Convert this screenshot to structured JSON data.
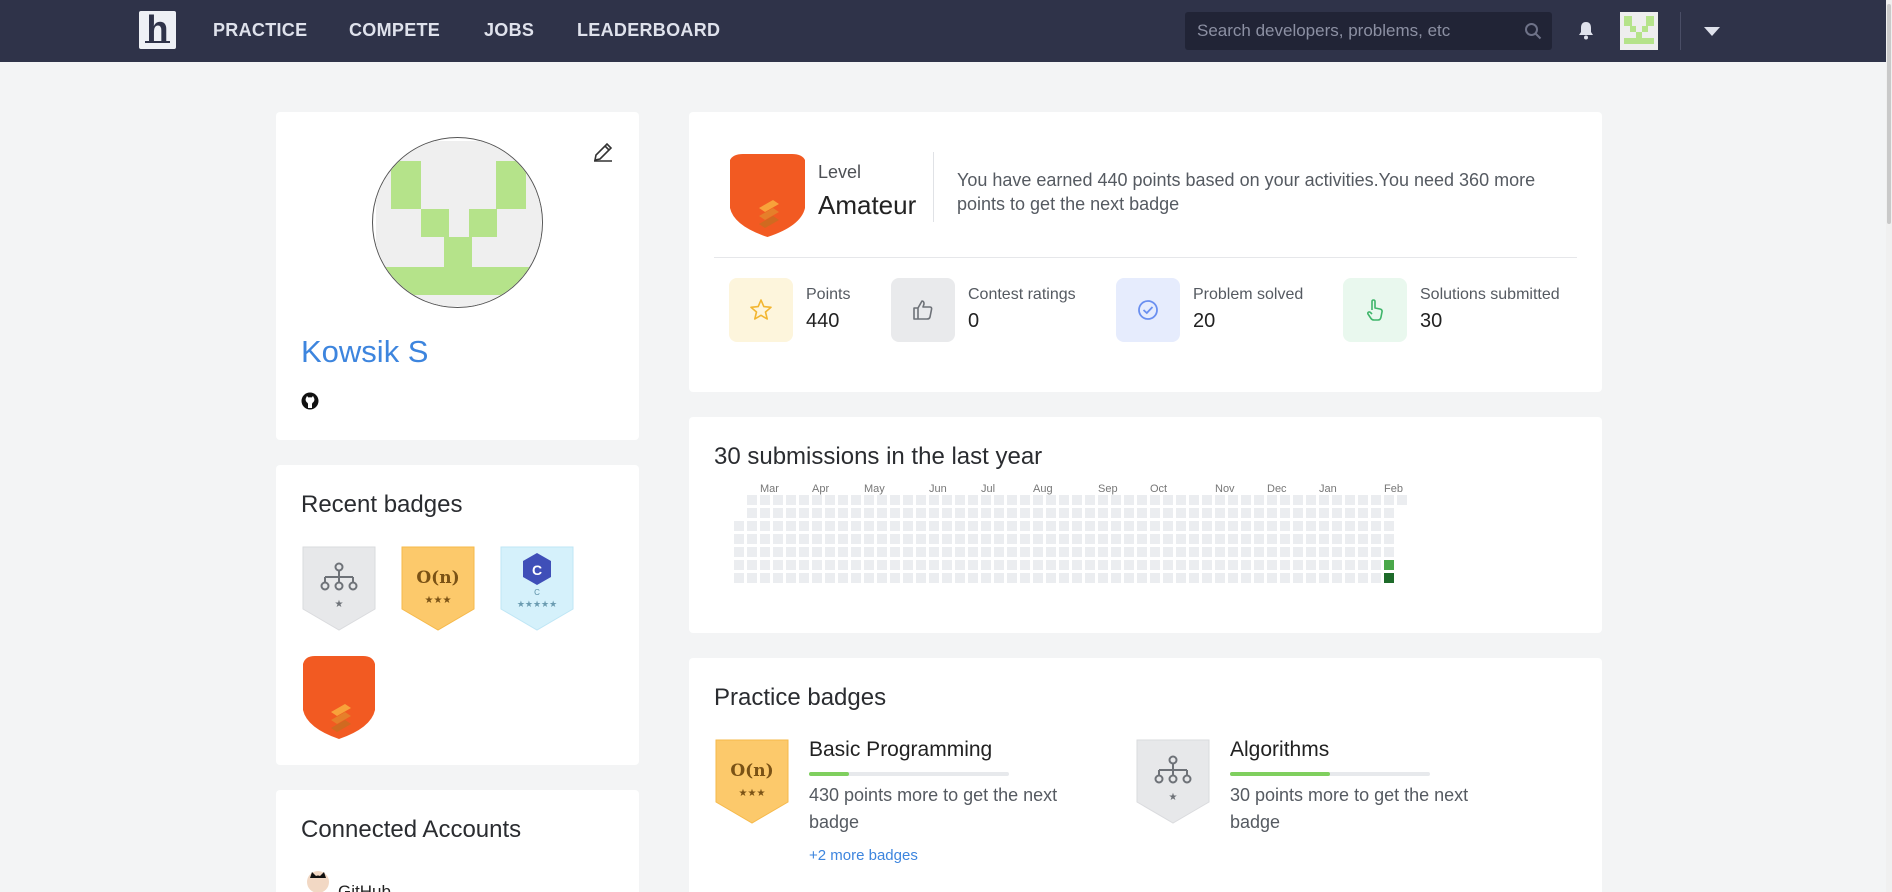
{
  "nav": {
    "logo_letter": "h",
    "links": [
      "PRACTICE",
      "COMPETE",
      "JOBS",
      "LEADERBOARD"
    ],
    "search_placeholder": "Search developers, problems, etc"
  },
  "profile": {
    "name": "Kowsik S",
    "avatar_color": "#b5e38a"
  },
  "recent_badges": {
    "title": "Recent badges",
    "items": [
      {
        "icon": "algorithms-tree-icon",
        "stars": "★"
      },
      {
        "icon": "big-o-icon",
        "symbol": "O(n)",
        "stars": "★★★"
      },
      {
        "icon": "c-language-icon",
        "symbol": "C",
        "stars": "★★★★★"
      },
      {
        "icon": "amateur-level-shield-icon"
      }
    ]
  },
  "connected": {
    "title": "Connected Accounts",
    "first_account": "GitHub"
  },
  "level": {
    "label": "Level",
    "name": "Amateur",
    "description": "You have earned 440 points based on your activities.You need 360 more points to get the next badge",
    "shield_color": "#f25a22"
  },
  "stats": [
    {
      "label": "Points",
      "value": "440",
      "icon": "star-icon",
      "bg": "#fdf5dc"
    },
    {
      "label": "Contest ratings",
      "value": "0",
      "icon": "thumbs-up-icon",
      "bg": "#e9eaec"
    },
    {
      "label": "Problem solved",
      "value": "20",
      "icon": "check-circle-icon",
      "bg": "#e6ecfd"
    },
    {
      "label": "Solutions submitted",
      "value": "30",
      "icon": "pointer-hand-icon",
      "bg": "#e9f8ee"
    }
  ],
  "submissions": {
    "title": "30 submissions in the last year",
    "months": [
      "Mar",
      "Apr",
      "May",
      "Jun",
      "Jul",
      "Aug",
      "Sep",
      "Oct",
      "Nov",
      "Dec",
      "Jan",
      "Feb"
    ],
    "active_color": "#4aa84a",
    "strong_color": "#1e6b2a"
  },
  "practice_badges": {
    "title": "Practice badges",
    "items": [
      {
        "name": "Basic Programming",
        "text": "430 points more to get the next badge",
        "progress": 0.2,
        "icon": "big-o-icon",
        "symbol": "O(n)",
        "stars": "★★★",
        "more": "+2 more badges"
      },
      {
        "name": "Algorithms",
        "text": "30 points more to get the next badge",
        "progress": 0.5,
        "icon": "algorithms-tree-icon",
        "stars": "★"
      }
    ]
  }
}
